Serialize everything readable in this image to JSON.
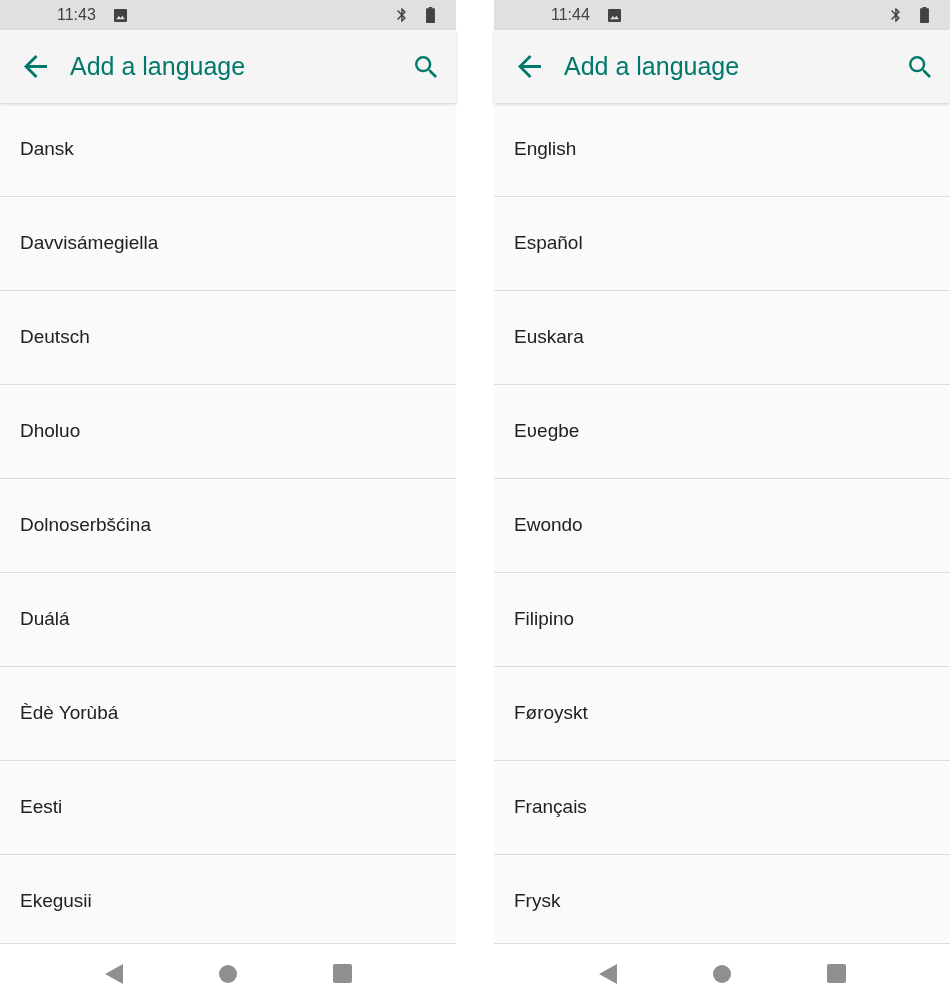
{
  "screens": [
    {
      "status_bar": {
        "time": "11:43"
      },
      "app_bar": {
        "title": "Add a language"
      },
      "languages": [
        "Dansk",
        "Davvisámegiella",
        "Deutsch",
        "Dholuo",
        "Dolnoserbšćina",
        "Duálá",
        "Èdè Yorùbá",
        "Eesti",
        "Ekegusii"
      ]
    },
    {
      "status_bar": {
        "time": "11:44"
      },
      "app_bar": {
        "title": "Add a language"
      },
      "languages": [
        "English",
        "Español",
        "Euskara",
        "Eʋegbe",
        "Ewondo",
        "Filipino",
        "Føroyskt",
        "Français",
        "Frysk"
      ]
    }
  ]
}
